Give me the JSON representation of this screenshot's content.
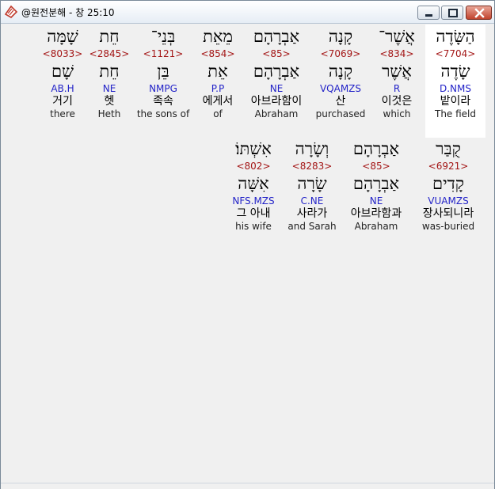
{
  "window": {
    "title": "@원전분해 - 창 25:10",
    "controls": {
      "minimize_icon": "minimize-icon",
      "maximize_icon": "maximize-icon",
      "close_icon": "close-icon"
    }
  },
  "rows": [
    [
      {
        "heb": "הַשָּׂדֶה",
        "strong": "<7704>",
        "heb_lex": "שָׂדֶה",
        "morph": "D.NMS",
        "kor": "밭이라",
        "eng": "The field",
        "highlighted": true
      },
      {
        "heb": "אֲשֶׁר־",
        "strong": "<834>",
        "heb_lex": "אֲשֶׁר",
        "morph": "R",
        "kor": "이것은",
        "eng": "which"
      },
      {
        "heb": "קָנָה",
        "strong": "<7069>",
        "heb_lex": "קָנָה",
        "morph": "VQAMZS",
        "kor": "산",
        "eng": "purchased"
      },
      {
        "heb": "אַבְרָהָם",
        "strong": "<85>",
        "heb_lex": "אַבְרָהָם",
        "morph": "NE",
        "kor": "아브라함이",
        "eng": "Abraham"
      },
      {
        "heb": "מֵאֵת",
        "strong": "<854>",
        "heb_lex": "אֵת",
        "morph": "P.P",
        "kor": "에게서",
        "eng": "of"
      },
      {
        "heb": "בְּנֵי־",
        "strong": "<1121>",
        "heb_lex": "בֵּן",
        "morph": "NMPG",
        "kor": "족속",
        "eng": "the sons of"
      },
      {
        "heb": "חֵת",
        "strong": "<2845>",
        "heb_lex": "חֵת",
        "morph": "NE",
        "kor": "헷",
        "eng": "Heth"
      },
      {
        "heb": "שָׁמָּה",
        "strong": "<8033>",
        "heb_lex": "שָׁם",
        "morph": "AB.H",
        "kor": "거기",
        "eng": "there"
      }
    ],
    [
      {
        "heb": "קֻבַּר",
        "strong": "<6921>",
        "heb_lex": "קָדִים",
        "morph": "VUAMZS",
        "kor": "장사되니라",
        "eng": "was-buried"
      },
      {
        "heb": "אַבְרָהָם",
        "strong": "<85>",
        "heb_lex": "אַבְרָהָם",
        "morph": "NE",
        "kor": "아브라함과",
        "eng": "Abraham"
      },
      {
        "heb": "וְשָׂרָה",
        "strong": "<8283>",
        "heb_lex": "שָׂרָה",
        "morph": "C.NE",
        "kor": "사라가",
        "eng": "and Sarah"
      },
      {
        "heb": "אִשְׁתּוֹ׃",
        "strong": "<802>",
        "heb_lex": "אִשָּׁה",
        "morph": "NFS.MZS",
        "kor": "그 아내",
        "eng": "his wife"
      }
    ]
  ]
}
